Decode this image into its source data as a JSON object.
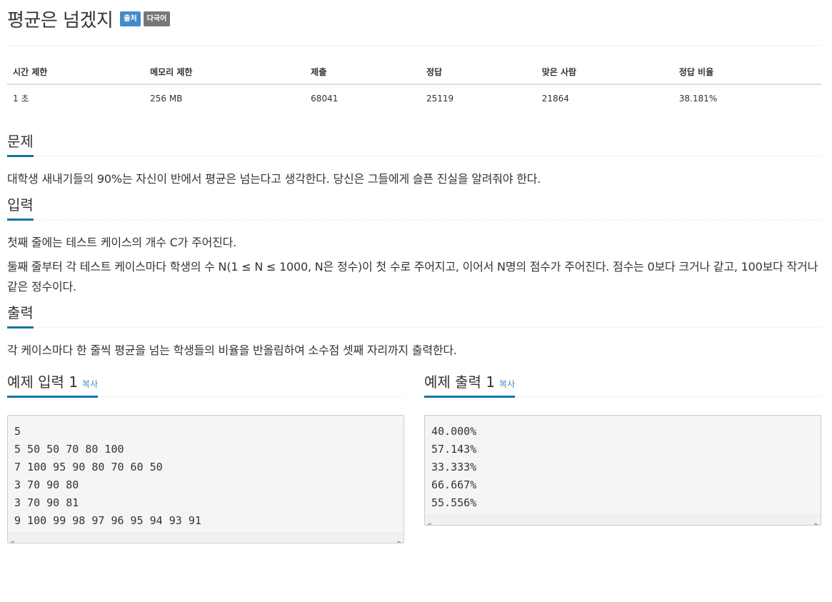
{
  "header": {
    "title": "평균은 넘겠지",
    "badge_source": "출처",
    "badge_multilang": "다국어"
  },
  "stats": {
    "columns": [
      "시간 제한",
      "메모리 제한",
      "제출",
      "정답",
      "맞은 사람",
      "정답 비율"
    ],
    "values": [
      "1 초",
      "256 MB",
      "68041",
      "25119",
      "21864",
      "38.181%"
    ]
  },
  "problem": {
    "heading": "문제",
    "text": "대학생 새내기들의 90%는 자신이 반에서 평균은 넘는다고 생각한다. 당신은 그들에게 슬픈 진실을 알려줘야 한다."
  },
  "input": {
    "heading": "입력",
    "line1": "첫째 줄에는 테스트 케이스의 개수 C가 주어진다.",
    "line2": "둘째 줄부터 각 테스트 케이스마다 학생의 수 N(1 ≤ N ≤ 1000, N은 정수)이 첫 수로 주어지고, 이어서 N명의 점수가 주어진다. 점수는 0보다 크거나 같고, 100보다 작거나 같은 정수이다."
  },
  "output": {
    "heading": "출력",
    "text": "각 케이스마다 한 줄씩 평균을 넘는 학생들의 비율을 반올림하여 소수점 셋째 자리까지 출력한다."
  },
  "sample_input": {
    "heading": "예제 입력 1",
    "copy_label": "복사",
    "content": "5\n5 50 50 70 80 100\n7 100 95 90 80 70 60 50\n3 70 90 80\n3 70 90 81\n9 100 99 98 97 96 95 94 93 91"
  },
  "sample_output": {
    "heading": "예제 출력 1",
    "copy_label": "복사",
    "content": "40.000%\n57.143%\n33.333%\n66.667%\n55.556%"
  },
  "colors": {
    "accent_underline": "#0e76a8",
    "badge_source": "#428bca",
    "badge_multilang": "#777777",
    "link": "#428bca"
  }
}
